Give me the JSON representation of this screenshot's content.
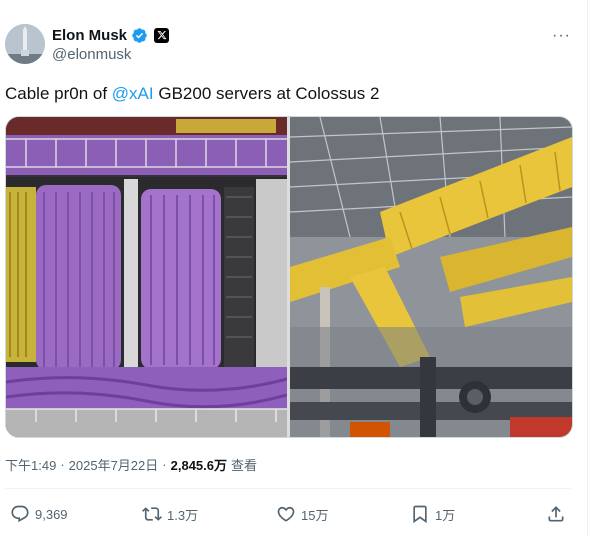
{
  "author": {
    "name": "Elon Musk",
    "handle": "@elonmusk"
  },
  "menu": {
    "more_icon_label": "···"
  },
  "tweet": {
    "text_before": "Cable pr0n of ",
    "mention": "@xAI",
    "text_after": " GB200 servers at Colossus 2"
  },
  "meta": {
    "time": "下午1:49",
    "dot1": "·",
    "date": "2025年7月22日",
    "dot2": "·",
    "views": "2,845.6万",
    "views_label": "查看"
  },
  "actions": {
    "replies": "9,369",
    "reposts": "1.3万",
    "likes": "15万",
    "bookmarks": "1万"
  },
  "colors": {
    "accent": "#1d9bf0",
    "secondary_text": "#536471",
    "cable_purple": "#9b6bc4",
    "cable_yellow": "#e8c53a"
  }
}
